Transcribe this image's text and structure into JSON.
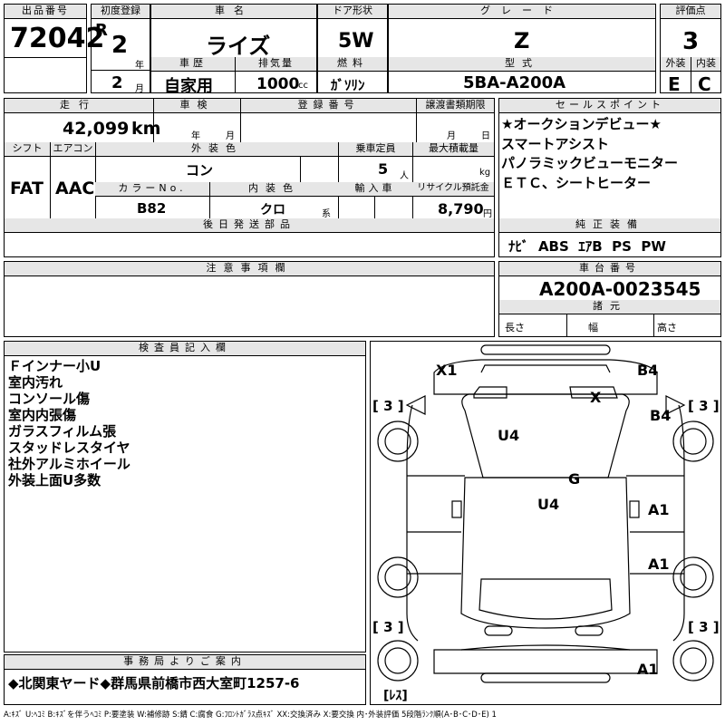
{
  "header": {
    "lot_label": "出品番号",
    "lot_no": "72042",
    "first_reg_label": "初度登録",
    "era": "R",
    "year_val": "2",
    "year_unit": "年",
    "month_val": "2",
    "month_unit": "月",
    "name_label": "車名",
    "name": "ライズ",
    "door_label": "ドア形状",
    "door": "5W",
    "grade_label": "グレード",
    "grade": "Z",
    "score_label": "評価点",
    "score": "3",
    "history_label": "車歴",
    "history": "自家用",
    "disp_label": "排気量",
    "disp": "1000",
    "disp_unit": "cc",
    "fuel_label": "燃料",
    "fuel": "ｶﾞｿﾘﾝ",
    "model_label": "型式",
    "model": "5BA-A200A",
    "ext_label": "外装",
    "ext": "E",
    "int_label": "内装",
    "int": "C"
  },
  "row2": {
    "mileage_label": "走行",
    "mileage": "42,099",
    "mileage_unit": "km",
    "inspection_label": "車検",
    "insp_year": "年",
    "insp_month": "月",
    "reg_label": "登録番号",
    "doc_label": "譲渡書類期限",
    "doc_month": "月",
    "doc_day": "日",
    "shift_label": "シフト",
    "shift": "FAT",
    "ac_label": "エアコン",
    "ac": "AAC",
    "color_label": "外装色",
    "color": "コン",
    "cap_label": "乗車定員",
    "cap": "5",
    "cap_unit": "人",
    "load_label": "最大積載量",
    "load_unit": "kg",
    "colorno_label": "カラーNo.",
    "colorno": "B82",
    "intcolor_label": "内装色",
    "intcolor": "クロ",
    "intcolor_unit": "系",
    "import_label": "輸入車",
    "recycle_label": "リサイクル預託金",
    "recycle": "8,790",
    "recycle_unit": "円",
    "later_label": "後日発送部品"
  },
  "sales_points": {
    "label": "セールスポイント",
    "items": [
      "★オークションデビュー★",
      "スマートアシスト",
      "パノラミックビューモニター",
      "ＥＴＣ、シートヒーター"
    ]
  },
  "equipment": {
    "label": "純正装備",
    "value": "ﾅﾋﾞ  ABS  ｴｱB  PS  PW"
  },
  "notice": {
    "label": "注意事項欄"
  },
  "chassis": {
    "label": "車台番号",
    "value": "A200A-0023545",
    "spec_label": "諸元",
    "length": "長さ",
    "width": "幅",
    "height": "高さ"
  },
  "inspector": {
    "label": "検査員記入欄",
    "lines": [
      "Ｆインナー小U",
      "室内汚れ",
      "コンソール傷",
      "室内内張傷",
      "ガラスフィルム張",
      "スタッドレスタイヤ",
      "社外アルミホイール",
      "外装上面U多数"
    ]
  },
  "diagram": {
    "x1": "X1",
    "b4a": "B4",
    "x": "X",
    "b4b": "B4",
    "u4a": "U4",
    "g": "G",
    "u4b": "U4",
    "a1a": "A1",
    "a1b": "A1",
    "a1c": "A1",
    "t1": "[ 3 ]",
    "t2": "[ 3 ]",
    "t3": "[ 3 ]",
    "t4": "[ 3 ]",
    "res": "[ﾚｽ]"
  },
  "office": {
    "label": "事務局よりご案内",
    "text": "◆北関東ヤード◆群馬県前橋市西大室町1257-6"
  },
  "legend": "A:ｷｽﾞ U:ﾍｺﾐ B:ｷｽﾞを伴うﾍｺﾐ P:要塗装 W:補修跡 S:錆 C:腐食 G:ﾌﾛﾝﾄｶﾞﾗｽ点ｷｽﾞ XX:交換済み X:要交換  内･外装評価  5段階ﾗﾝｸ順(A･B･C･D･E) 1"
}
